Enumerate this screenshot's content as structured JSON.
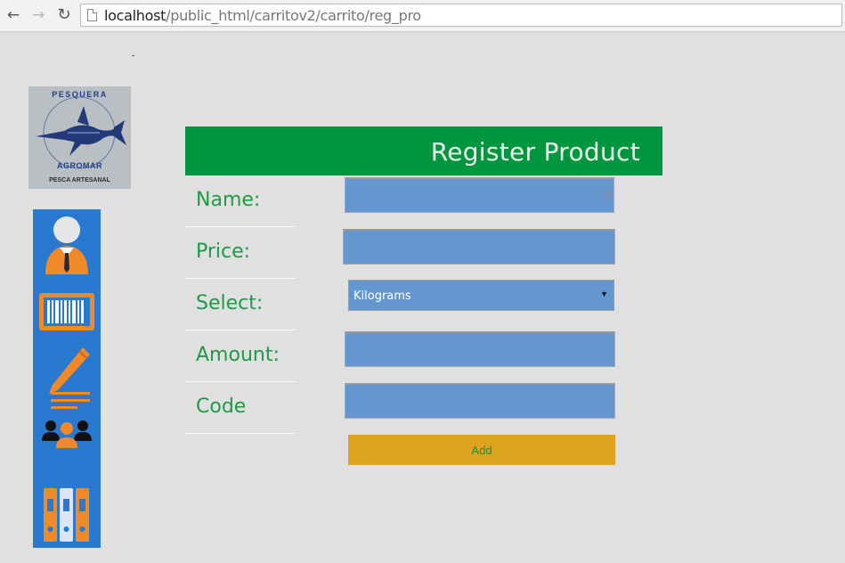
{
  "browser": {
    "url_host": "localhost",
    "url_path": "/public_html/carritov2/carrito/reg_pro",
    "back_glyph": "←",
    "forward_glyph": "→",
    "reload_glyph": "↻"
  },
  "logo": {
    "top_text": "PESQUERA",
    "mid_text": "AGROMAR",
    "bottom_text": "PESCA ARTESANAL"
  },
  "sidebar": {
    "items": [
      {
        "icon": "user-icon"
      },
      {
        "icon": "barcode-icon"
      },
      {
        "icon": "pencil-icon"
      },
      {
        "icon": "users-icon"
      },
      {
        "icon": "binders-icon"
      }
    ]
  },
  "form": {
    "title": "Register Product",
    "labels": {
      "name": "Name:",
      "price": "Price:",
      "select": "Select:",
      "amount": "Amount:",
      "code": "Code"
    },
    "fields": {
      "name_value": "",
      "price_value": "",
      "amount_value": "",
      "code_value": ""
    },
    "unit_select": "Kilograms",
    "add_label": "Add"
  },
  "colors": {
    "header": "#00963f",
    "label_text": "#1f9a46",
    "input_bg": "#6497d0",
    "sidebar_bg": "#2979d0",
    "button_bg": "#dda420",
    "icon_orange": "#f08a28"
  }
}
